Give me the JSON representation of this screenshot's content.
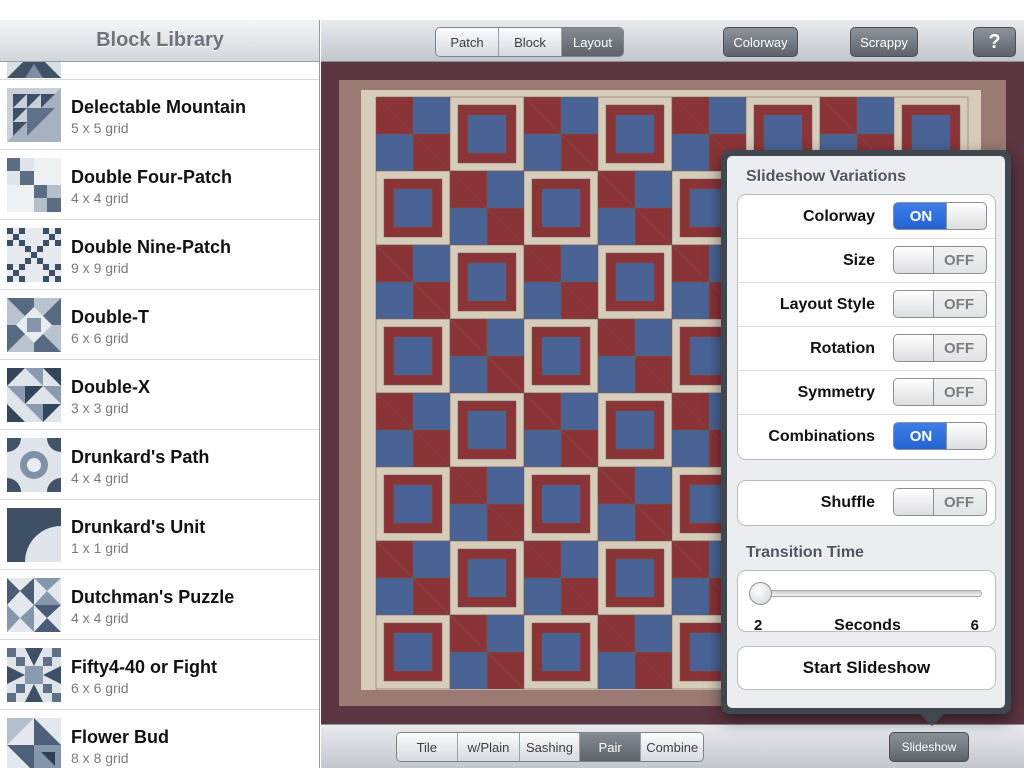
{
  "colors": {
    "quilt_red": "#8b3438",
    "quilt_blue": "#4a6397",
    "quilt_cream": "#d7ccba",
    "quilt_border": "#5c3641",
    "toggle_on": "#2f6fde"
  },
  "sidebar": {
    "title": "Block Library",
    "items": [
      {
        "name": "Delectable Mountain",
        "grid": "5 x 5 grid",
        "thumb": "delectable-mountain"
      },
      {
        "name": "Double Four-Patch",
        "grid": "4 x 4 grid",
        "thumb": "double-four-patch"
      },
      {
        "name": "Double Nine-Patch",
        "grid": "9 x 9 grid",
        "thumb": "double-nine-patch"
      },
      {
        "name": "Double-T",
        "grid": "6 x 6 grid",
        "thumb": "double-t"
      },
      {
        "name": "Double-X",
        "grid": "3 x 3 grid",
        "thumb": "double-x"
      },
      {
        "name": "Drunkard's Path",
        "grid": "4 x 4 grid",
        "thumb": "drunkards-path"
      },
      {
        "name": "Drunkard's Unit",
        "grid": "1 x 1 grid",
        "thumb": "drunkards-unit"
      },
      {
        "name": "Dutchman's Puzzle",
        "grid": "4 x 4 grid",
        "thumb": "dutchmans-puzzle"
      },
      {
        "name": "Fifty4-40 or Fight",
        "grid": "6 x 6 grid",
        "thumb": "fifty-four-forty"
      },
      {
        "name": "Flower Bud",
        "grid": "8 x 8 grid",
        "thumb": "flower-bud"
      }
    ]
  },
  "top_toolbar": {
    "modes": [
      "Patch",
      "Block",
      "Layout"
    ],
    "selected_mode": "Layout",
    "colorway": "Colorway",
    "scrappy": "Scrappy",
    "help": "?"
  },
  "bottom_toolbar": {
    "layouts": [
      "Tile",
      "w/Plain",
      "Sashing",
      "Pair",
      "Combine"
    ],
    "selected_layout": "Pair",
    "slideshow": "Slideshow"
  },
  "popover": {
    "title": "Slideshow Variations",
    "options": [
      {
        "label": "Colorway",
        "state": "ON"
      },
      {
        "label": "Size",
        "state": "OFF"
      },
      {
        "label": "Layout Style",
        "state": "OFF"
      },
      {
        "label": "Rotation",
        "state": "OFF"
      },
      {
        "label": "Symmetry",
        "state": "OFF"
      },
      {
        "label": "Combinations",
        "state": "ON"
      }
    ],
    "shuffle": {
      "label": "Shuffle",
      "state": "OFF"
    },
    "transition_title": "Transition Time",
    "slider": {
      "min": "2",
      "max": "6",
      "unit": "Seconds",
      "value": 2
    },
    "start": "Start Slideshow"
  }
}
